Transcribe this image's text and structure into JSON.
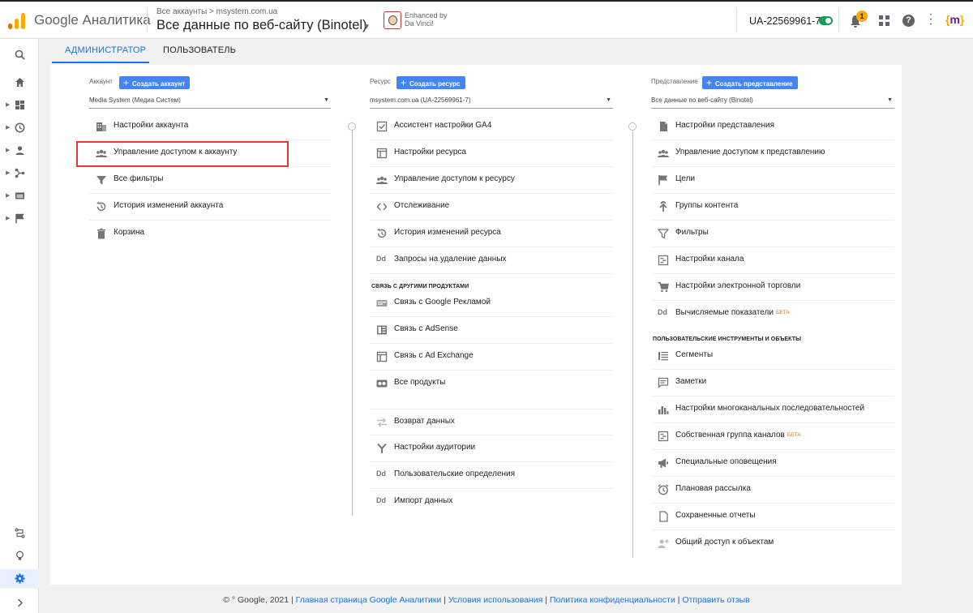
{
  "header": {
    "brand": "Google Аналитика",
    "breadcrumb": "Все аккаунты > msystem.com.ua",
    "view_title": "Все данные по веб-сайту (Binotel)",
    "extension_text_1": "Enhanced by",
    "extension_text_2": "Da Vinci!",
    "tracking_id": "UA-22569961-7",
    "notification_count": "1",
    "account_logo": "{m}"
  },
  "tabs": [
    {
      "label": "АДМИНИСТРАТОР",
      "active": true
    },
    {
      "label": "ПОЛЬЗОВАТЕЛЬ",
      "active": false
    }
  ],
  "account": {
    "heading": "Аккаунт",
    "add_label": "Создать аккаунт",
    "selected": "Media System (Медиа Систем)",
    "items": [
      {
        "label": "Настройки аккаунта",
        "icon": "building-icon"
      },
      {
        "label": "Управление доступом к аккаунту",
        "icon": "people-icon"
      },
      {
        "label": "Все фильтры",
        "icon": "filter-icon"
      },
      {
        "label": "История изменений аккаунта",
        "icon": "history-icon"
      },
      {
        "label": "Корзина",
        "icon": "trash-icon"
      }
    ]
  },
  "property": {
    "heading": "Ресурс",
    "add_label": "Создать ресурс",
    "selected": "msystem.com.ua (UA-22569961-7)",
    "items": [
      {
        "label": "Ассистент настройки GA4",
        "icon": "checkbox-icon"
      },
      {
        "label": "Настройки ресурса",
        "icon": "window-icon"
      },
      {
        "label": "Управление доступом к ресурсу",
        "icon": "people-icon"
      },
      {
        "label": "Отслеживание",
        "icon": "code-icon"
      },
      {
        "label": "История изменений ресурса",
        "icon": "history-icon"
      },
      {
        "label": "Запросы на удаление данных",
        "icon": "dd-icon"
      }
    ],
    "linking_heading": "СВЯЗЬ С ДРУГИМИ ПРОДУКТАМИ",
    "linking_items": [
      {
        "label": "Связь с Google Рекламой",
        "icon": "ads-icon"
      },
      {
        "label": "Связь с AdSense",
        "icon": "adsense-icon"
      },
      {
        "label": "Связь с Ad Exchange",
        "icon": "adexchange-icon"
      },
      {
        "label": "Все продукты",
        "icon": "products-icon"
      }
    ],
    "more_items": [
      {
        "label": "Возврат данных",
        "icon": "arrows-icon"
      },
      {
        "label": "Настройки аудитории",
        "icon": "fork-icon"
      },
      {
        "label": "Пользовательские определения",
        "icon": "dd-icon"
      },
      {
        "label": "Импорт данных",
        "icon": "dd-icon"
      }
    ]
  },
  "view": {
    "heading": "Представление",
    "add_label": "Создать представление",
    "selected": "Все данные по веб-сайту (Binotel)",
    "items": [
      {
        "label": "Настройки представления",
        "icon": "doc-icon"
      },
      {
        "label": "Управление доступом к представлению",
        "icon": "people-icon"
      },
      {
        "label": "Цели",
        "icon": "flag-icon"
      },
      {
        "label": "Группы контента",
        "icon": "branch-icon"
      },
      {
        "label": "Фильтры",
        "icon": "filter-icon"
      },
      {
        "label": "Настройки канала",
        "icon": "channel-icon"
      },
      {
        "label": "Настройки электронной торговли",
        "icon": "cart-icon"
      },
      {
        "label": "Вычисляемые показатели",
        "icon": "dd-icon",
        "beta": "БЕТА"
      }
    ],
    "tools_heading": "ПОЛЬЗОВАТЕЛЬСКИЕ ИНСТРУМЕНТЫ И ОБЪЕКТЫ",
    "tools_items": [
      {
        "label": "Сегменты",
        "icon": "segments-icon"
      },
      {
        "label": "Заметки",
        "icon": "notes-icon"
      },
      {
        "label": "Настройки многоканальных последовательностей",
        "icon": "barchart-icon"
      },
      {
        "label": "Собственная группа каналов",
        "icon": "channel-icon",
        "beta": "БЕТА"
      },
      {
        "label": "Специальные оповещения",
        "icon": "megaphone-icon"
      },
      {
        "label": "Плановая рассылка",
        "icon": "clock-icon"
      },
      {
        "label": "Сохраненные отчеты",
        "icon": "report-icon"
      },
      {
        "label": "Общий доступ к объектам",
        "icon": "share-icon"
      }
    ]
  },
  "footer": {
    "copyright": "© ° Google, 2021 |",
    "link_home": "Главная страница Google Аналитики",
    "link_terms": "Условия использования",
    "link_privacy": "Политика конфиденциальности",
    "link_feedback": "Отправить отзыв",
    "sep": "|"
  },
  "colors": {
    "accent": "#1a73e8",
    "button": "#4285f4",
    "highlight": "#e53935",
    "beta": "#e8710a"
  }
}
